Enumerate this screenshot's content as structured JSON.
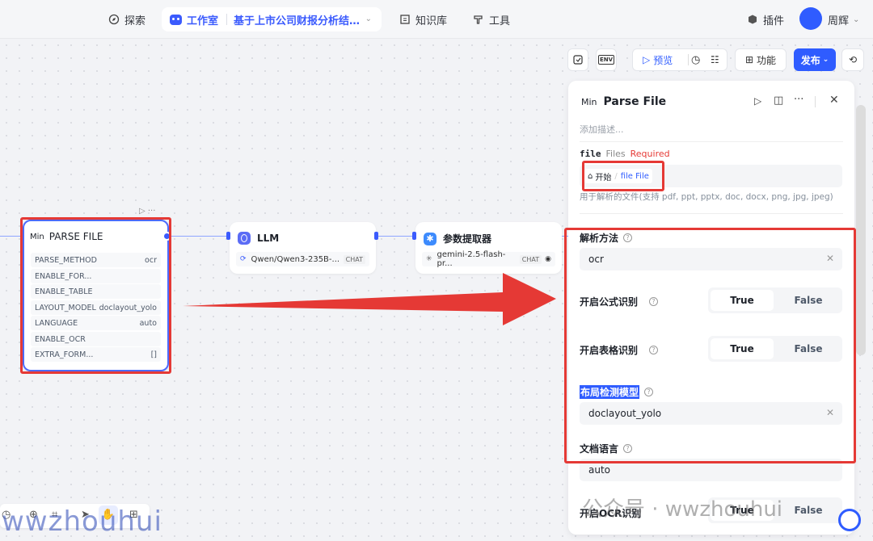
{
  "nav": {
    "explore": "探索",
    "studio": "工作室",
    "project": "基于上市公司财报分析结…",
    "knowledge": "知识库",
    "tools": "工具",
    "plugins": "插件",
    "user": "周辉"
  },
  "toolbar": {
    "preview": "预览",
    "features": "功能",
    "publish": "发布",
    "env": "ENV"
  },
  "nodes": {
    "parse": {
      "badge": "Min",
      "title": "PARSE FILE",
      "params": [
        {
          "key": "PARSE_METHOD",
          "value": "ocr"
        },
        {
          "key": "ENABLE_FOR...",
          "value": ""
        },
        {
          "key": "ENABLE_TABLE",
          "value": ""
        },
        {
          "key": "LAYOUT_MODEL",
          "value": "doclayout_yolo"
        },
        {
          "key": "LANGUAGE",
          "value": "auto"
        },
        {
          "key": "ENABLE_OCR",
          "value": ""
        },
        {
          "key": "EXTRA_FORM...",
          "value": "[]"
        }
      ]
    },
    "llm": {
      "title": "LLM",
      "model": "Qwen/Qwen3-235B-...",
      "tag": "CHAT"
    },
    "extractor": {
      "title": "参数提取器",
      "model": "gemini-2.5-flash-pr...",
      "tag": "CHAT"
    }
  },
  "panel": {
    "badge": "Min",
    "title": "Parse File",
    "desc_placeholder": "添加描述...",
    "file_label": "file",
    "file_type": "Files",
    "required": "Required",
    "file_source": "开始",
    "file_var": "file File",
    "file_hint": "用于解析的文件(支持 pdf, ppt, pptx, doc, docx, png, jpg, jpeg)",
    "parse_method_label": "解析方法",
    "parse_method_value": "ocr",
    "formula_label": "开启公式识别",
    "table_label": "开启表格识别",
    "layout_label": "布局检测模型",
    "layout_value": "doclayout_yolo",
    "language_label": "文档语言",
    "language_value": "auto",
    "ocr_label": "开启OCR识别",
    "true_label": "True",
    "false_label": "False"
  },
  "watermark": {
    "wechat": "公众号 · wwzhouhui",
    "corner": "wwzhouhui"
  },
  "colors": {
    "accent": "#2f5cff",
    "highlight": "#e53935"
  }
}
